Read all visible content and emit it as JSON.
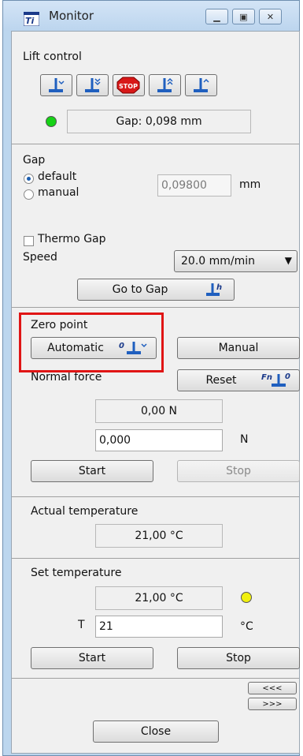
{
  "window": {
    "title": "Monitor"
  },
  "lift_control": {
    "label": "Lift control",
    "buttons": [
      "move-down-slow-icon",
      "move-down-fast-icon",
      "stop-icon",
      "move-up-fast-icon",
      "move-up-slow-icon"
    ],
    "stop_label": "STOP",
    "gap_readout": "Gap: 0,098 mm",
    "status_color": "#16d216"
  },
  "gap": {
    "label": "Gap",
    "options": [
      "default",
      "manual"
    ],
    "selected": "default",
    "value": "0,09800",
    "unit": "mm",
    "thermo_gap_label": "Thermo Gap",
    "speed_label": "Speed",
    "speed_value": "20.0 mm/min",
    "go_to_gap_label": "Go to Gap"
  },
  "zero_point": {
    "label": "Zero point",
    "automatic_label": "Automatic",
    "manual_label": "Manual"
  },
  "normal_force": {
    "label": "Normal force",
    "reset_label": "Reset",
    "reset_icon_text": "Fn",
    "reset_icon_sup": "0",
    "readout": "0,00 N",
    "input": "0,000",
    "unit": "N",
    "start_label": "Start",
    "stop_label": "Stop"
  },
  "actual_temperature": {
    "label": "Actual temperature",
    "value": "21,00 °C"
  },
  "set_temperature": {
    "label": "Set temperature",
    "readout": "21,00 °C",
    "status_color": "#f1f00f",
    "t_label": "T",
    "input": "21",
    "unit": "°C",
    "start_label": "Start",
    "stop_label": "Stop"
  },
  "nav": {
    "collapse_label": "<<<",
    "expand_label": ">>>"
  },
  "close_label": "Close"
}
